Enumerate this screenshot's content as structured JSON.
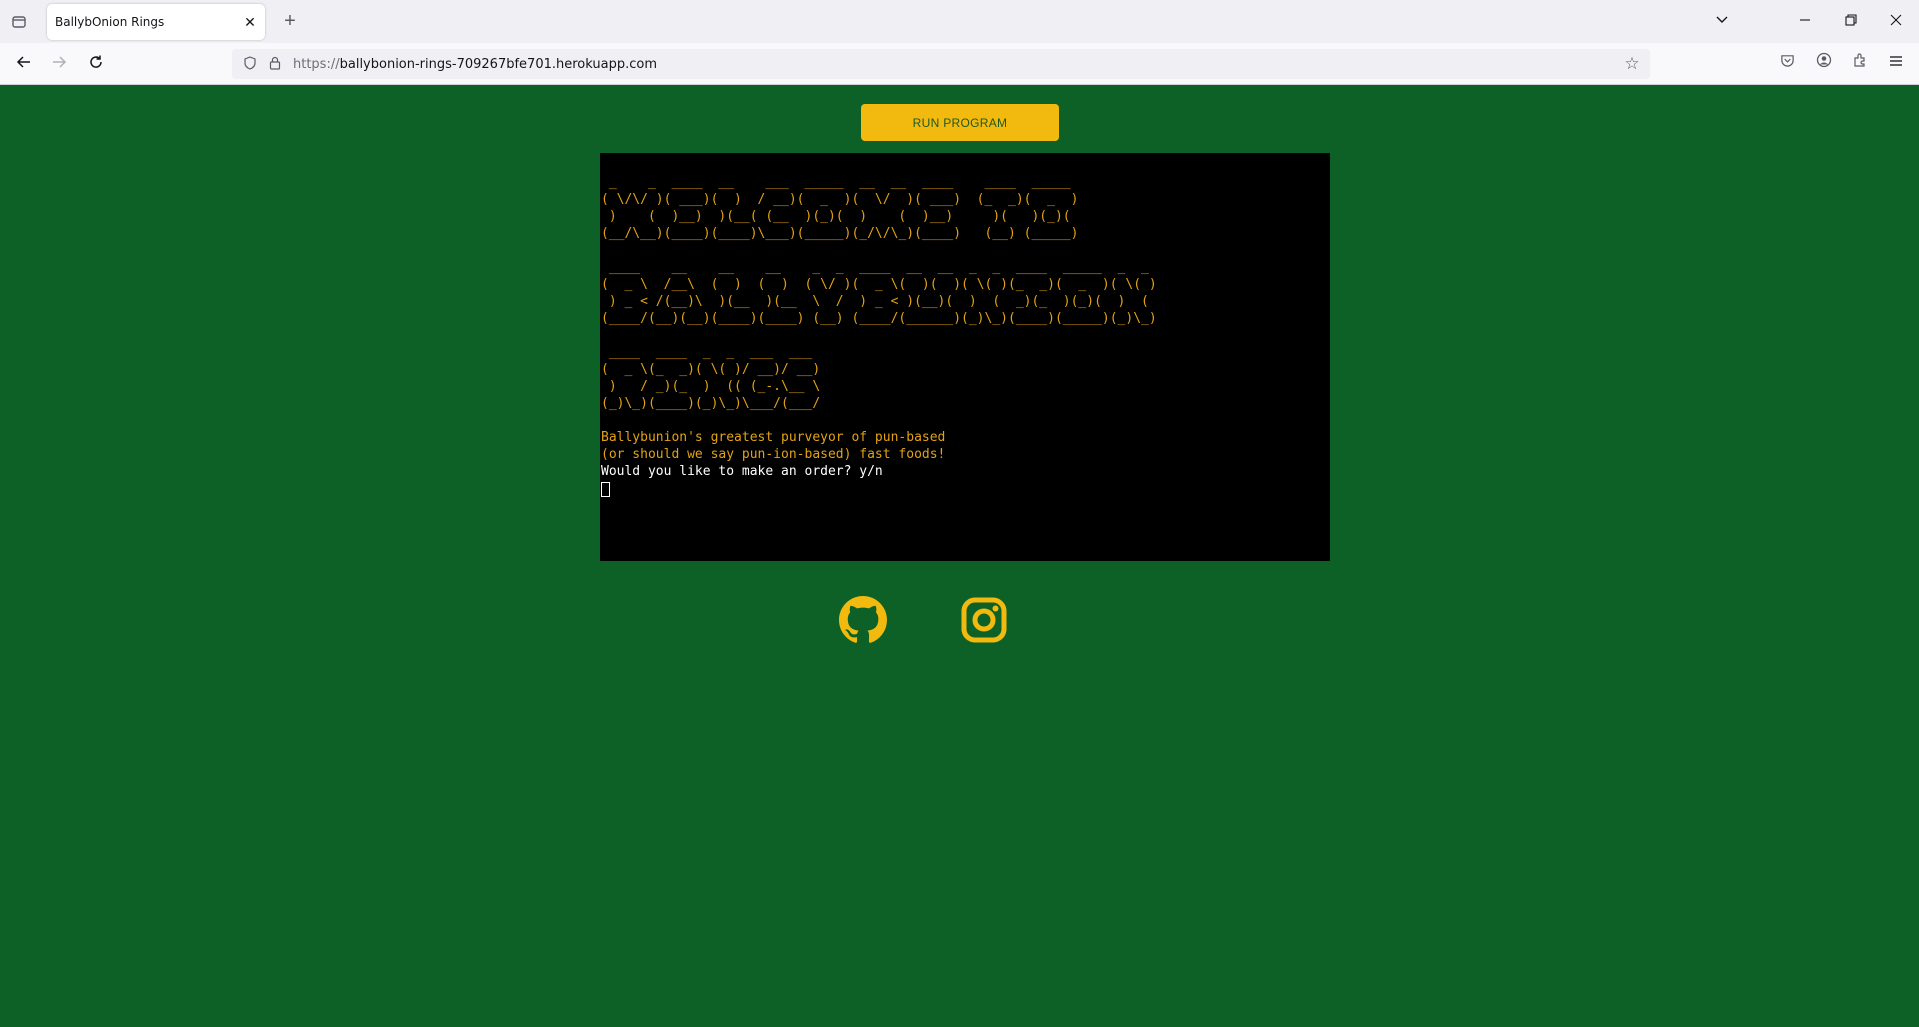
{
  "browser": {
    "tab_title": "BallybOnion Rings",
    "url_scheme": "https://",
    "url_host": "ballybonion-rings-709267bfe701.herokuapp.com"
  },
  "page": {
    "run_button_label": "RUN PROGRAM",
    "ascii_art": [
      " _    _  ____  __    ___  _____  __  __  ____    ____  _____ \n( \\/\\/ )( ___)(  )  / __)(  _  )(  \\/  )( ___)  (_  _)(  _  )\n )    (  )__)  )(__( (__  )(_)(  )    (  )__)     )(   )(_)( \n(__/\\__)(____)(____)\\___)(_____)(_/\\/\\_)(____)   (__) (_____)",
      " ____    __    __    __    _  _  ____  __  __  _  _  ____  _____  _  _ \n(  _ \\  /__\\  (  )  (  )  ( \\/ )(  _ \\(  )(  )( \\( )(_  _)(  _  )( \\( )\n ) _ < /(__)\\  )(__  )(__  \\  /  ) _ < )(__)(  )  (  _)(_  )(_)(  )  ( \n(____/(__)(__)(____)(____) (__) (____/(______)(_)\\_)(____)(_____)(_)\\_)",
      " ____  ____  _  _  ___  ___ \n(  _ \\(_  _)( \\( )/ __)/ __)\n )   / _)(_  )  (( (_-.\\__ \\\n(_)\\_)(____)(_)\\_)\\___/(___/"
    ],
    "tagline_1": "Ballybunion's greatest purveyor of pun-based",
    "tagline_2": "(or should we say pun-ion-based) fast foods!",
    "prompt": "Would you like to make an order? y/n"
  },
  "colors": {
    "page_background": "#0d6126",
    "accent_yellow": "#f2b90f",
    "terminal_background": "#000000"
  },
  "icons": {
    "github": "github-icon",
    "instagram": "instagram-icon"
  }
}
